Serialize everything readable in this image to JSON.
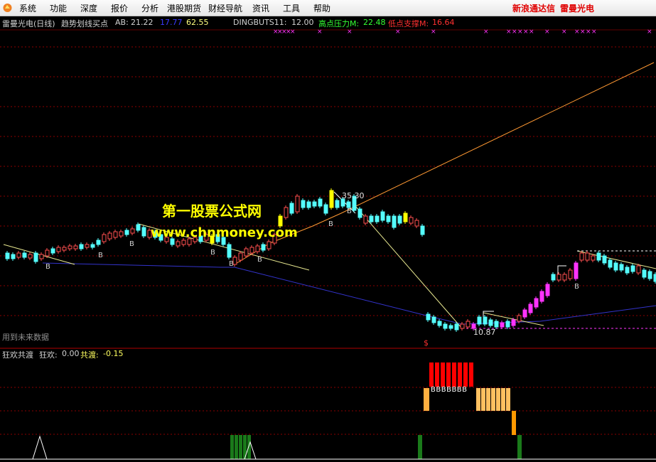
{
  "menu": {
    "items": [
      "系统",
      "功能",
      "深度",
      "报价",
      "分析",
      "港股期货",
      "财经导航",
      "资讯",
      "工具",
      "帮助"
    ],
    "brand_left": "新浪通达信",
    "brand_right": "雷曼光电"
  },
  "header": {
    "stock_title": "雷曼光电(日线)",
    "indicator_name": "趋势划线买点",
    "ab_label": "AB:",
    "ab_value": "21.22",
    "ab2_value": "17.77",
    "ab3_value": "62.55",
    "dingbuts_label": "DINGBUTS11:",
    "dingbuts_value": "12.00",
    "high_label": "高点压力M:",
    "high_value": "22.48",
    "low_label": "低点支撑M:",
    "low_value": "16.64"
  },
  "annotations": {
    "peak_price": "35.30",
    "trough_price": "10.87",
    "future_data_note": "用到未来数据",
    "s_marker": "$",
    "b_marker": "B",
    "cross_marker": "×"
  },
  "sub_panel": {
    "title": "狂欢共渡",
    "kh_label": "狂欢:",
    "kh_value": "0.00",
    "gd_label": "共渡:",
    "gd_value": "-0.15",
    "b_label_row": "BBBBBBB"
  },
  "watermark": {
    "site_name": "第一股票公式网",
    "site_url": "www.chnmoney.com"
  },
  "colors": {
    "up": "#ff5050",
    "down": "#54fcfc",
    "yellow": "#ffff00",
    "magenta": "#ff33ff",
    "orange_line": "#ff9933",
    "blue_line": "#3333cc",
    "grid": "#8b0000"
  }
}
